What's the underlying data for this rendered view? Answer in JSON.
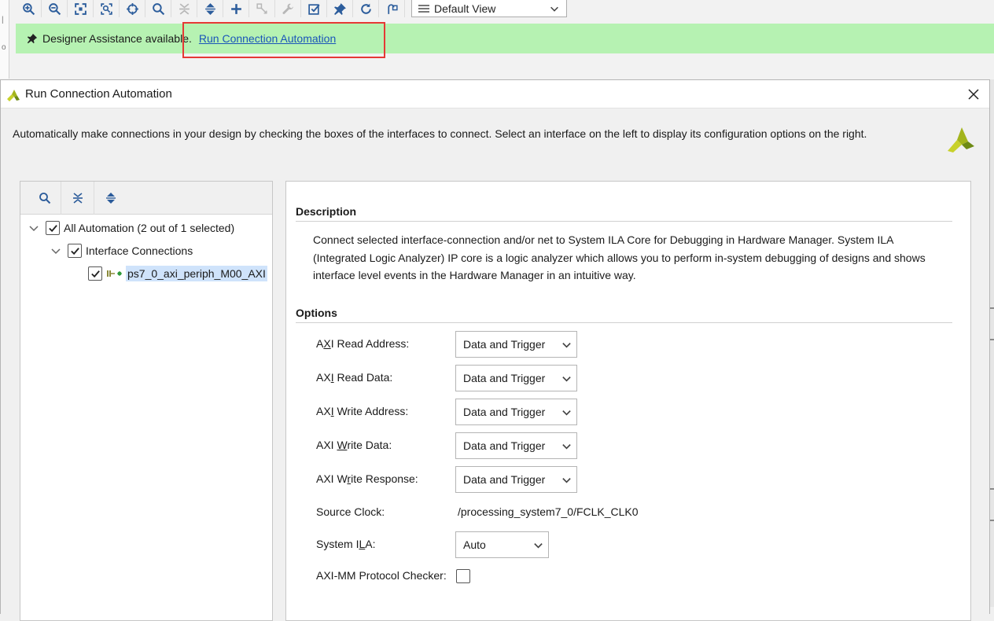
{
  "toolbar": {
    "buttons": [
      "zoom-in",
      "zoom-out",
      "zoom-fit",
      "zoom-area",
      "auto-connect",
      "search",
      "collapse-all",
      "expand-all",
      "add-ip",
      "make-external",
      "validate-wrench",
      "validate-design",
      "pin",
      "refresh",
      "regenerate-layout"
    ],
    "view_select": "Default View"
  },
  "assistance": {
    "message": "Designer Assistance available.",
    "link": "Run Connection Automation"
  },
  "dialog": {
    "title": "Run Connection Automation",
    "intro": "Automatically make connections in your design by checking the boxes of the interfaces to connect. Select an interface on the left to display its configuration options on the right.",
    "tree": {
      "root_label": "All Automation (2 out of 1 selected)",
      "group_label": "Interface Connections",
      "item_label": "ps7_0_axi_periph_M00_AXI"
    },
    "description_header": "Description",
    "description": "Connect selected interface-connection and/or net to System ILA Core for Debugging in Hardware Manager. System ILA (Integrated Logic Analyzer) IP core is a logic analyzer which allows you to perform in-system debugging of designs and shows interface level events in the Hardware Manager in an intuitive way.",
    "options_header": "Options",
    "options": [
      {
        "label_pre": "A",
        "label_u": "X",
        "label_post": "I Read Address:",
        "value": "Data and Trigger"
      },
      {
        "label_pre": "AX",
        "label_u": "I",
        "label_post": " Read Data:",
        "value": "Data and Trigger"
      },
      {
        "label_pre": "AX",
        "label_u": "I",
        "label_post": " Write Address:",
        "value": "Data and Trigger"
      },
      {
        "label_pre": "AXI ",
        "label_u": "W",
        "label_post": "rite Data:",
        "value": "Data and Trigger"
      },
      {
        "label_pre": "AXI W",
        "label_u": "r",
        "label_post": "ite Response:",
        "value": "Data and Trigger"
      }
    ],
    "source_clock_label": "Source Clock:",
    "source_clock_value": "/processing_system7_0/FCLK_CLK0",
    "system_ila_label_pre": "System I",
    "system_ila_label_u": "L",
    "system_ila_label_post": "A:",
    "system_ila_value": "Auto",
    "protocol_checker_label": "AXI-MM Protocol Checker:"
  },
  "colors": {
    "assist_bar": "#b6f2b2",
    "link": "#1a55b9",
    "highlight": "#e53935",
    "selection": "#cfe3fb",
    "logo_yellow": "#c8d12a",
    "logo_green": "#6d8a14"
  }
}
